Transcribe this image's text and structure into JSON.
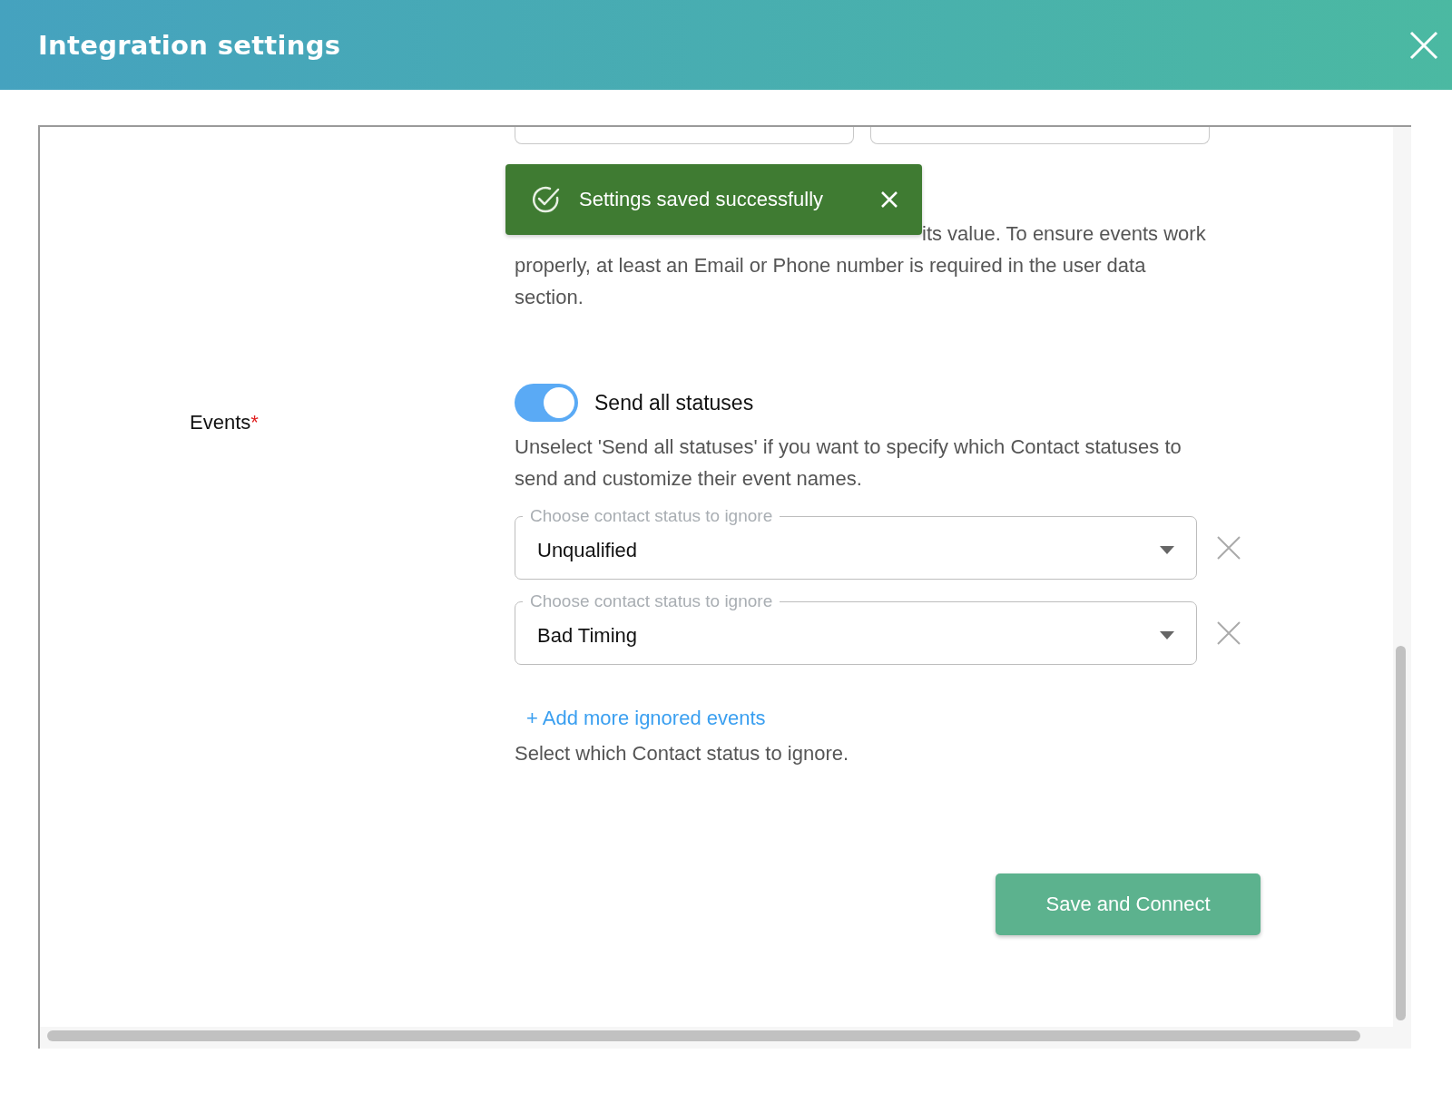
{
  "dialog": {
    "title": "Integration settings"
  },
  "toast": {
    "message": "Settings saved successfully"
  },
  "data_points": {
    "help": "its value. To ensure events work properly, at least an Email or Phone number is required in the user data section."
  },
  "events": {
    "label": "Events",
    "required_mark": "*",
    "send_all": {
      "label": "Send all statuses",
      "on": true
    },
    "description": "Unselect 'Send all statuses' if you want to specify which Contact statuses to send and customize their event names.",
    "ignored": [
      {
        "label": "Choose contact status to ignore",
        "value": "Unqualified"
      },
      {
        "label": "Choose contact status to ignore",
        "value": "Bad Timing"
      }
    ],
    "add_link": "+ Add more ignored events",
    "help": "Select which Contact status to ignore."
  },
  "buttons": [
    {
      "label": "Save and Connect"
    }
  ]
}
